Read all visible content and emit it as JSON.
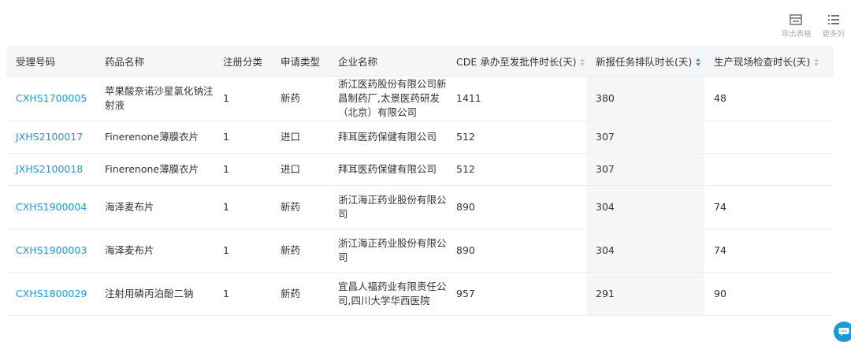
{
  "toolbar": {
    "export": {
      "label": "导出表格",
      "icon": "table-export-icon"
    },
    "more": {
      "label": "更多列",
      "icon": "list-columns-icon"
    }
  },
  "columns": [
    {
      "label": "受理号码",
      "sortable": false
    },
    {
      "label": "药品名称",
      "sortable": false
    },
    {
      "label": "注册分类",
      "sortable": false
    },
    {
      "label": "申请类型",
      "sortable": false
    },
    {
      "label": "企业名称",
      "sortable": false
    },
    {
      "label": "CDE 承办至发批件时长(天)",
      "sortable": true,
      "active": false
    },
    {
      "label": "新报任务排队时长(天)",
      "sortable": true,
      "active": true
    },
    {
      "label": "生产现场检查时长(天)",
      "sortable": true,
      "active": false
    }
  ],
  "rows": [
    {
      "acceptance_no": "CXHS1700005",
      "drug_name": "苹果酸奈诺沙星氯化钠注射液",
      "reg_class": "1",
      "app_type": "新药",
      "company": "浙江医药股份有限公司新昌制药厂,太景医药研发（北京）有限公司",
      "cde_days": "1411",
      "queue_days": "380",
      "inspection_days": "48"
    },
    {
      "acceptance_no": "JXHS2100017",
      "drug_name": "Finerenone薄膜衣片",
      "reg_class": "1",
      "app_type": "进口",
      "company": "拜耳医药保健有限公司",
      "cde_days": "512",
      "queue_days": "307",
      "inspection_days": ""
    },
    {
      "acceptance_no": "JXHS2100018",
      "drug_name": "Finerenone薄膜衣片",
      "reg_class": "1",
      "app_type": "进口",
      "company": "拜耳医药保健有限公司",
      "cde_days": "512",
      "queue_days": "307",
      "inspection_days": ""
    },
    {
      "acceptance_no": "CXHS1900004",
      "drug_name": "海泽麦布片",
      "reg_class": "1",
      "app_type": "新药",
      "company": "浙江海正药业股份有限公司",
      "cde_days": "890",
      "queue_days": "304",
      "inspection_days": "74"
    },
    {
      "acceptance_no": "CXHS1900003",
      "drug_name": "海泽麦布片",
      "reg_class": "1",
      "app_type": "新药",
      "company": "浙江海正药业股份有限公司",
      "cde_days": "890",
      "queue_days": "304",
      "inspection_days": "74"
    },
    {
      "acceptance_no": "CXHS1800029",
      "drug_name": "注射用磷丙泊酚二钠",
      "reg_class": "1",
      "app_type": "新药",
      "company": "宜昌人福药业有限责任公司,四川大学华西医院",
      "cde_days": "957",
      "queue_days": "291",
      "inspection_days": "90"
    }
  ],
  "colors": {
    "link": "#1a9bd7",
    "sort_active": "#3a8ee6",
    "header_bg": "#f5f6f8",
    "chat_button": "#1a9bd7"
  },
  "chat_button_icon": "chat-bubble-icon"
}
